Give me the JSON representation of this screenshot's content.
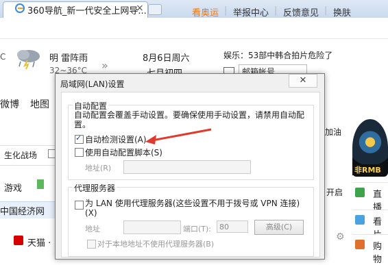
{
  "browser": {
    "tab_title": "360导航_新一代安全上网导...",
    "tab_close": "×"
  },
  "toplinks": [
    "看奥运",
    "举报中心",
    "反馈意见",
    "换肤"
  ],
  "weather": {
    "left_unit": "C",
    "condition": "明 雷阵雨",
    "temp": "32~36°C",
    "date": "8月6日周六",
    "lunar": "七月初四"
  },
  "entertainment": "娱乐：53部中韩合拍片危险了",
  "mailbox_placeholder": "邮箱帐号",
  "nav": {
    "weibo": "微博",
    "map": "地图",
    "jiayou": "加油"
  },
  "game": {
    "label": "生化战场",
    "sub": "游戏"
  },
  "start": "开启",
  "sites": {
    "cn_econ": "中国经济网",
    "tmall": "天猫 ·"
  },
  "side": {
    "badge": "非RMB",
    "items": [
      "直播",
      "看片",
      "购物"
    ]
  },
  "dialog": {
    "title": "局域网(LAN)设置",
    "close": "✕",
    "auto_group": "自动配置",
    "auto_desc": "自动配置会覆盖手动设置。要确保使用手动设置，请禁用自动配置。",
    "detect_label": "自动检测设置(A)",
    "detect_checked": true,
    "script_label": "使用自动配置脚本(S)",
    "script_checked": false,
    "address_label": "地址(R)",
    "proxy_group": "代理服务器",
    "proxy_label": "为 LAN 使用代理服务器(这些设置不用于拨号或 VPN 连接)(X)",
    "proxy_checked": false,
    "proxy_address_label": "地址",
    "port_label": "端口(T):",
    "port_value": "80",
    "advanced_button": "高级(C)",
    "bypass_label": "对于本地地址不使用代理服务器(B)"
  },
  "colors": {
    "orange_link": "#e8791d",
    "arrow_red": "#e03a2e",
    "dialog_bg": "#f0f0f0"
  }
}
